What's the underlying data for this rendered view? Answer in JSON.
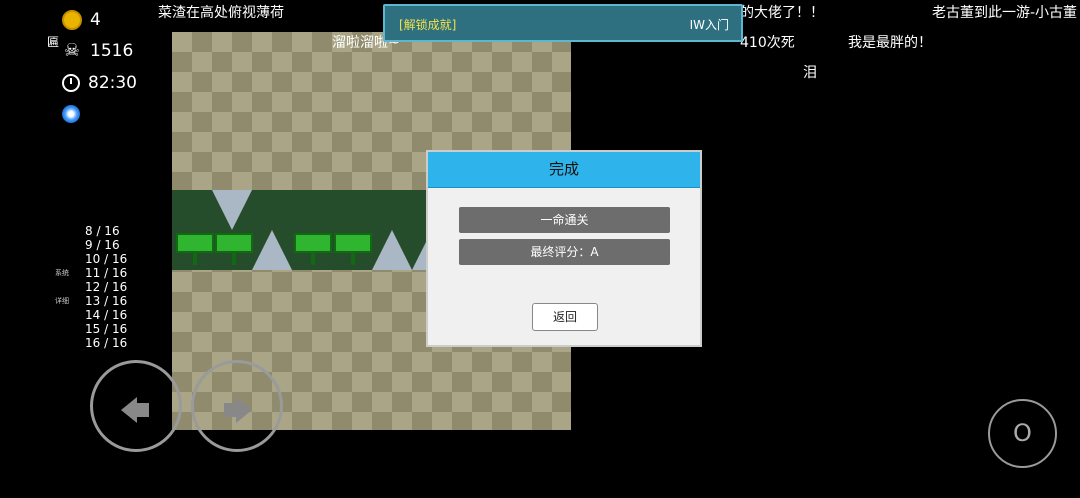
{
  "hud": {
    "coins": "4",
    "deaths": "1516",
    "time": "82:30"
  },
  "progress_list": [
    "8 / 16",
    "9 / 16",
    "10 / 16",
    "11 / 16",
    "12 / 16",
    "13 / 16",
    "14 / 16",
    "15 / 16",
    "16 / 16"
  ],
  "side_labels": {
    "system": "系统",
    "detail": "详细"
  },
  "danmaku": {
    "d1": "菜渣在高处俯视薄荷",
    "d2": "溜啦溜啦~",
    "d3": "的大佬了！！",
    "d4": "410次死",
    "d5": "老古董到此一游-小古董",
    "d6": "我是最胖的！",
    "d7": "泪",
    "d8": "匾"
  },
  "achievement": {
    "tag": "[解锁成就]",
    "name": "IW入门"
  },
  "dialog": {
    "title": "完成",
    "result1": "一命通关",
    "result2": "最终评分：A",
    "back_label": "返回"
  },
  "controls": {
    "jump_label": "O"
  },
  "colors": {
    "dialog_header": "#2eb4ea",
    "achievement_bg": "#2e6f80",
    "corridor": "#264d2b",
    "sign": "#2fb52f"
  }
}
